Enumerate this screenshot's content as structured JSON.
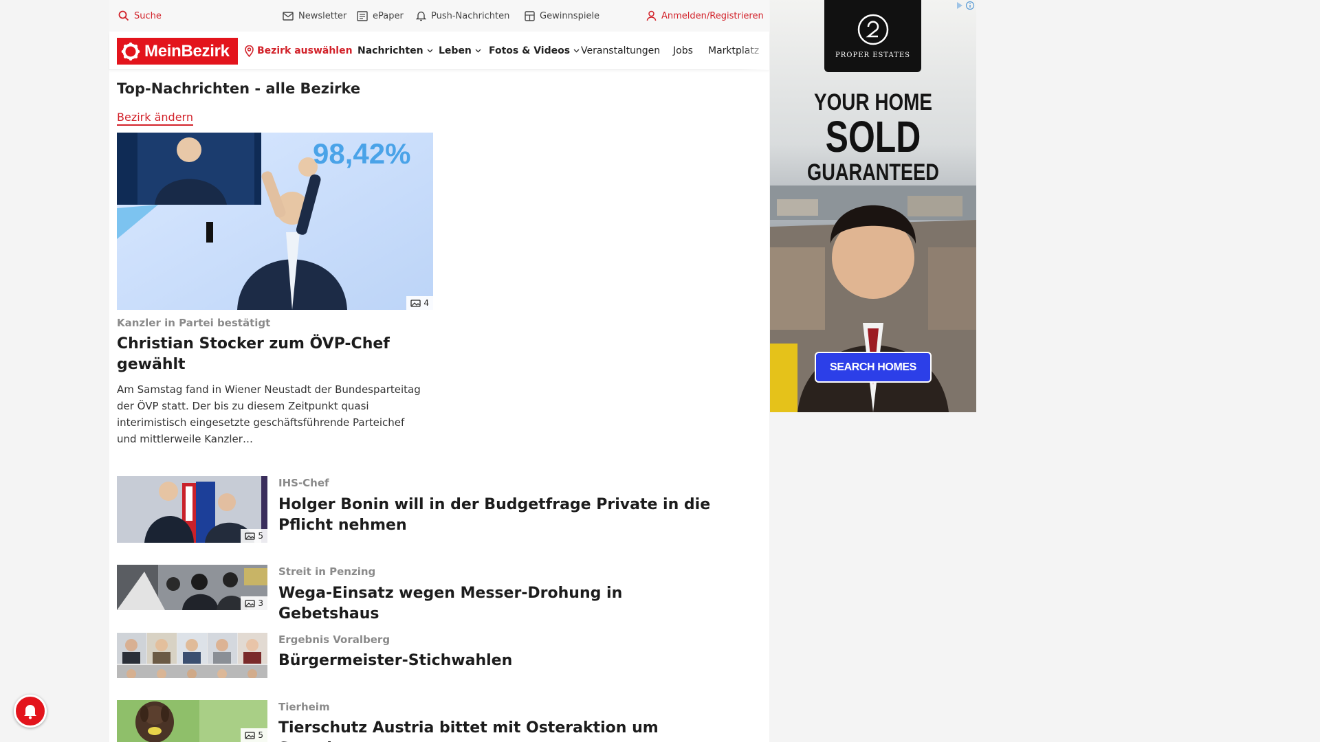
{
  "topbar": {
    "search": "Suche",
    "newsletter": "Newsletter",
    "epaper": "ePaper",
    "push": "Push-Nachrichten",
    "gewinnspiele": "Gewinnspiele",
    "login": "Anmelden/Registrieren"
  },
  "nav": {
    "logo": "MeinBezirk",
    "bezirk": "Bezirk auswählen",
    "items": [
      "Nachrichten",
      "Leben",
      "Fotos & Videos",
      "Veranstaltungen",
      "Jobs",
      "Marktplatz"
    ]
  },
  "main": {
    "title": "Top-Nachrichten - alle Bezirke",
    "change_link": "Bezirk ändern",
    "lead": {
      "image_overlay": "98,42%",
      "image_count": "4",
      "kicker": "Kanzler in Partei bestätigt",
      "headline": "Christian Stocker zum ÖVP-Chef gewählt",
      "teaser": "Am Samstag fand in Wiener Neustadt der Bundesparteitag der ÖVP statt. Der bis zu diesem Zeitpunkt quasi interimistisch eingesetzte geschäftsführende Parteichef und mittlerweile Kanzler…"
    },
    "articles": [
      {
        "kicker": "IHS-Chef",
        "headline": "Holger Bonin will in der Budgetfrage Private in die Pflicht nehmen",
        "image_count": "5"
      },
      {
        "kicker": "Streit in Penzing",
        "headline": "Wega-Einsatz wegen Messer-Drohung in Gebetshaus",
        "image_count": "3"
      },
      {
        "kicker": "Ergebnis Voralberg",
        "headline": "Bürgermeister-Stichwahlen",
        "image_count": ""
      },
      {
        "kicker": "Tierheim",
        "headline": "Tierschutz Austria bittet mit Osteraktion um Spenden",
        "image_count": "5"
      }
    ]
  },
  "ad": {
    "brand": "PROPER ESTATES",
    "line1": "YOUR HOME",
    "line2": "SOLD",
    "line3": "GUARANTEED",
    "cta": "SEARCH HOMES"
  },
  "colors": {
    "accent": "#e3141c",
    "link": "#d2222a",
    "ad_cta": "#2c3fe8"
  },
  "icons": [
    "search-icon",
    "mail-icon",
    "newspaper-icon",
    "bell-icon",
    "gift-icon",
    "user-icon",
    "location-pin-icon",
    "chevron-down-icon",
    "camera-icon"
  ]
}
